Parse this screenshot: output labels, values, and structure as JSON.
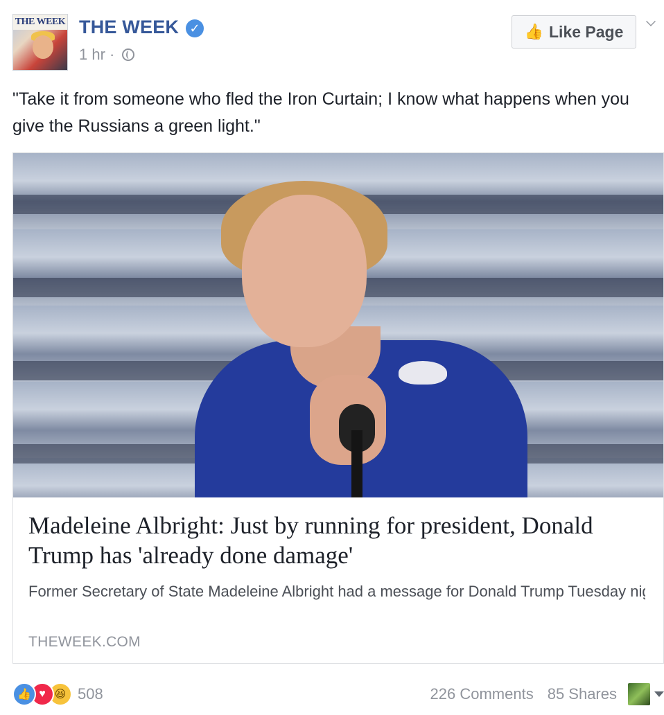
{
  "header": {
    "avatar_masthead": "THE WEEK",
    "page_name": "THE WEEK",
    "timestamp": "1 hr",
    "separator": "·",
    "like_page_label": "Like Page"
  },
  "post": {
    "text": "\"Take it from someone who fled the Iron Curtain; I know what happens when you give the Russians a green light.\""
  },
  "link_card": {
    "title": "Madeleine Albright: Just by running for president, Donald Trump has 'already done damage'",
    "description": "Former Secretary of State Madeleine Albright had a message for Donald Trump Tuesday night at the Democratic National Convention: \"Safeguarding freedom…",
    "domain": "THEWEEK.COM"
  },
  "footer": {
    "reaction_count": "508",
    "comments": "226 Comments",
    "shares": "85 Shares"
  },
  "colors": {
    "brand_blue": "#365899",
    "meta_gray": "#90949c",
    "like_blue": "#4a90e2",
    "love_red": "#f0284a",
    "haha_yellow": "#f7c33b"
  },
  "icons": [
    "verified-badge-icon",
    "globe-icon",
    "thumbs-up-icon",
    "chevron-down-icon",
    "like-reaction-icon",
    "love-reaction-icon",
    "haha-reaction-icon",
    "caret-down-icon"
  ]
}
